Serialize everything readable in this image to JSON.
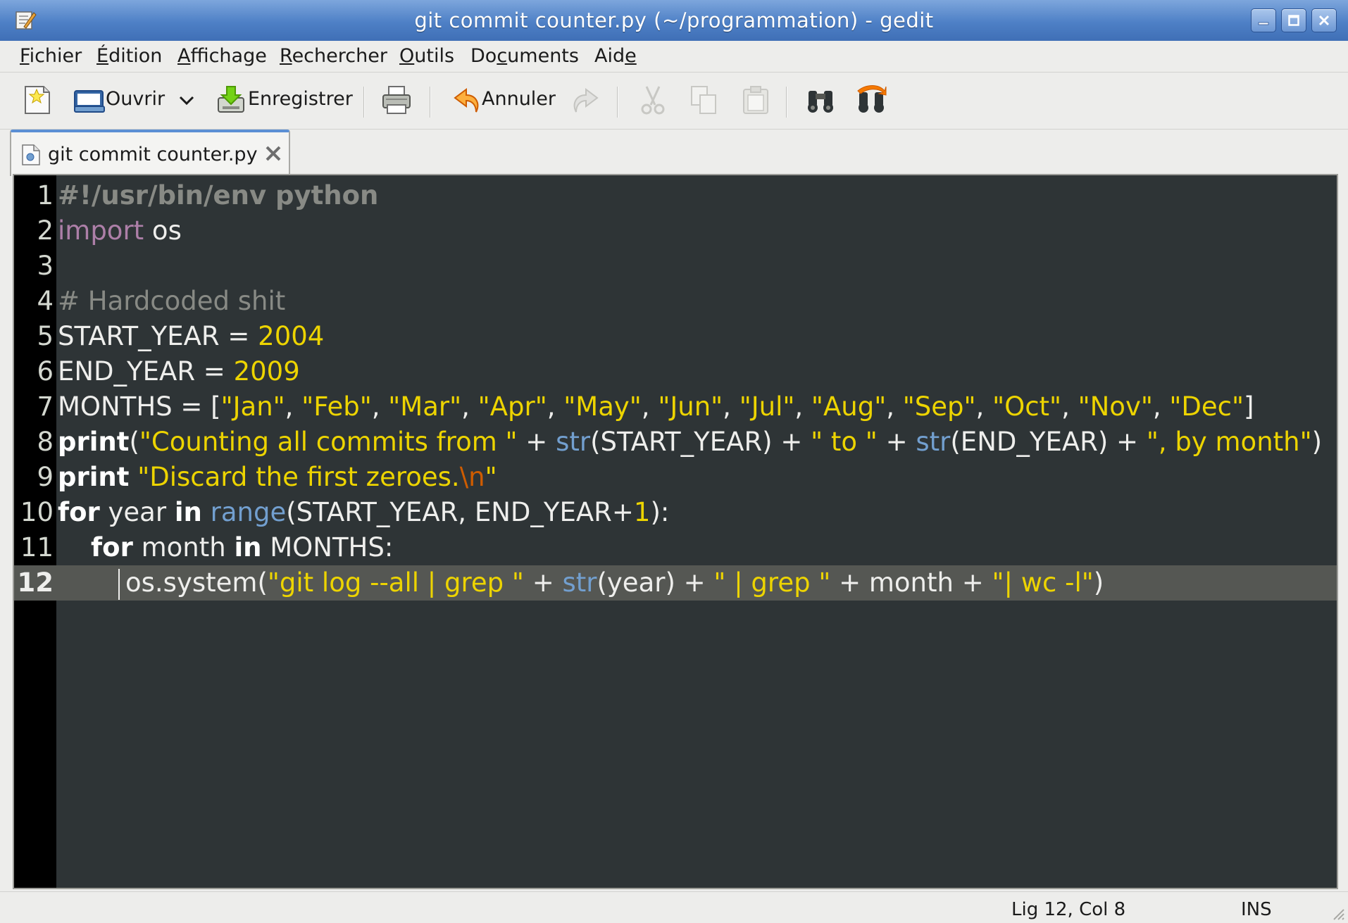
{
  "window": {
    "title": "git commit counter.py (~/programmation) - gedit"
  },
  "menu": [
    {
      "pre": "",
      "u": "F",
      "post": "ichier"
    },
    {
      "pre": "",
      "u": "É",
      "post": "dition"
    },
    {
      "pre": "",
      "u": "A",
      "post": "ffichage"
    },
    {
      "pre": "",
      "u": "R",
      "post": "echercher"
    },
    {
      "pre": "",
      "u": "O",
      "post": "utils"
    },
    {
      "pre": "Do",
      "u": "c",
      "post": "uments"
    },
    {
      "pre": "Aid",
      "u": "e",
      "post": ""
    }
  ],
  "toolbar": {
    "open_label": "Ouvrir",
    "save_label": "Enregistrer",
    "undo_label": "Annuler"
  },
  "tab": {
    "label": "git commit counter.py"
  },
  "editor": {
    "current_line": 12,
    "line_numbers": [
      "1",
      "2",
      "3",
      "4",
      "5",
      "6",
      "7",
      "8",
      "9",
      "10",
      "11",
      "12"
    ],
    "lines": [
      [
        {
          "c": "t-shebang",
          "t": "#!/usr/bin/env python"
        }
      ],
      [
        {
          "c": "t-import",
          "t": "import"
        },
        {
          "c": "t-plain",
          "t": " os"
        }
      ],
      [],
      [
        {
          "c": "t-comment",
          "t": "# Hardcoded shit"
        }
      ],
      [
        {
          "c": "t-plain",
          "t": "START_YEAR = "
        },
        {
          "c": "t-num",
          "t": "2004"
        }
      ],
      [
        {
          "c": "t-plain",
          "t": "END_YEAR = "
        },
        {
          "c": "t-num",
          "t": "2009"
        }
      ],
      [
        {
          "c": "t-plain",
          "t": "MONTHS = ["
        },
        {
          "c": "t-str",
          "t": "\"Jan\""
        },
        {
          "c": "t-plain",
          "t": ", "
        },
        {
          "c": "t-str",
          "t": "\"Feb\""
        },
        {
          "c": "t-plain",
          "t": ", "
        },
        {
          "c": "t-str",
          "t": "\"Mar\""
        },
        {
          "c": "t-plain",
          "t": ", "
        },
        {
          "c": "t-str",
          "t": "\"Apr\""
        },
        {
          "c": "t-plain",
          "t": ", "
        },
        {
          "c": "t-str",
          "t": "\"May\""
        },
        {
          "c": "t-plain",
          "t": ", "
        },
        {
          "c": "t-str",
          "t": "\"Jun\""
        },
        {
          "c": "t-plain",
          "t": ", "
        },
        {
          "c": "t-str",
          "t": "\"Jul\""
        },
        {
          "c": "t-plain",
          "t": ", "
        },
        {
          "c": "t-str",
          "t": "\"Aug\""
        },
        {
          "c": "t-plain",
          "t": ", "
        },
        {
          "c": "t-str",
          "t": "\"Sep\""
        },
        {
          "c": "t-plain",
          "t": ", "
        },
        {
          "c": "t-str",
          "t": "\"Oct\""
        },
        {
          "c": "t-plain",
          "t": ", "
        },
        {
          "c": "t-str",
          "t": "\"Nov\""
        },
        {
          "c": "t-plain",
          "t": ", "
        },
        {
          "c": "t-str",
          "t": "\"Dec\""
        },
        {
          "c": "t-plain",
          "t": "]"
        }
      ],
      [
        {
          "c": "t-kw",
          "t": "print"
        },
        {
          "c": "t-plain",
          "t": "("
        },
        {
          "c": "t-str",
          "t": "\"Counting all commits from \""
        },
        {
          "c": "t-plain",
          "t": " + "
        },
        {
          "c": "t-builtin",
          "t": "str"
        },
        {
          "c": "t-plain",
          "t": "(START_YEAR) + "
        },
        {
          "c": "t-str",
          "t": "\" to \""
        },
        {
          "c": "t-plain",
          "t": " + "
        },
        {
          "c": "t-builtin",
          "t": "str"
        },
        {
          "c": "t-plain",
          "t": "(END_YEAR) + "
        },
        {
          "c": "t-str",
          "t": "\", by month\""
        },
        {
          "c": "t-plain",
          "t": ")"
        }
      ],
      [
        {
          "c": "t-kw",
          "t": "print"
        },
        {
          "c": "t-plain",
          "t": " "
        },
        {
          "c": "t-str",
          "t": "\"Discard the first zeroes."
        },
        {
          "c": "t-esc",
          "t": "\\n"
        },
        {
          "c": "t-str",
          "t": "\""
        }
      ],
      [
        {
          "c": "t-kw",
          "t": "for"
        },
        {
          "c": "t-plain",
          "t": " year "
        },
        {
          "c": "t-kw",
          "t": "in"
        },
        {
          "c": "t-plain",
          "t": " "
        },
        {
          "c": "t-builtin",
          "t": "range"
        },
        {
          "c": "t-plain",
          "t": "(START_YEAR, END_YEAR+"
        },
        {
          "c": "t-num",
          "t": "1"
        },
        {
          "c": "t-plain",
          "t": "):"
        }
      ],
      [
        {
          "c": "t-plain",
          "t": "    "
        },
        {
          "c": "t-kw",
          "t": "for"
        },
        {
          "c": "t-plain",
          "t": " month "
        },
        {
          "c": "t-kw",
          "t": "in"
        },
        {
          "c": "t-plain",
          "t": " MONTHS:"
        }
      ],
      [
        {
          "c": "t-plain",
          "t": "os.system("
        },
        {
          "c": "t-str",
          "t": "\"git log --all | grep \""
        },
        {
          "c": "t-plain",
          "t": " + "
        },
        {
          "c": "t-builtin",
          "t": "str"
        },
        {
          "c": "t-plain",
          "t": "(year) + "
        },
        {
          "c": "t-str",
          "t": "\" | grep \""
        },
        {
          "c": "t-plain",
          "t": " + month + "
        },
        {
          "c": "t-str",
          "t": "\"| wc -l\""
        },
        {
          "c": "t-plain",
          "t": ")"
        }
      ]
    ]
  },
  "status": {
    "position": "Lig 12, Col 8",
    "mode": "INS"
  }
}
